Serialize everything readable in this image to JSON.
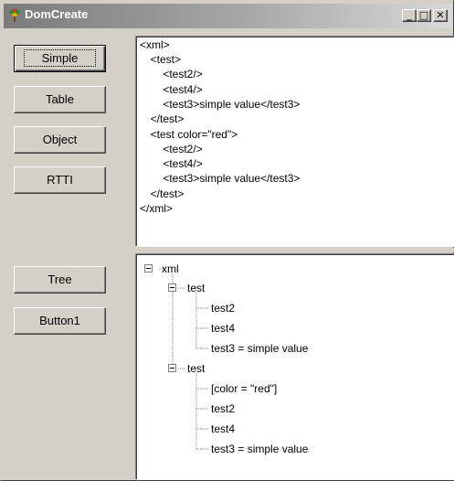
{
  "window": {
    "title": "DomCreate",
    "controls": {
      "minimize": "_",
      "maximize": "□",
      "close": "✕"
    }
  },
  "buttons": {
    "simple": "Simple",
    "table": "Table",
    "object": "Object",
    "rtti": "RTTI",
    "tree": "Tree",
    "button1": "Button1"
  },
  "memo": {
    "lines": [
      "<xml>",
      "  <test>",
      "    <test2/>",
      "    <test4/>",
      "    <test3>simple value</test3>",
      "  </test>",
      "  <test color=\"red\">",
      "    <test2/>",
      "    <test4/>",
      "    <test3>simple value</test3>",
      "  </test>",
      "</xml>"
    ]
  },
  "tree": {
    "root": "xml",
    "nodes": [
      {
        "label": "test",
        "children": [
          "test2",
          "test4",
          "test3 = simple value"
        ]
      },
      {
        "label": "test",
        "children": [
          "[color = \"red\"]",
          "test2",
          "test4",
          "test3 = simple value"
        ]
      }
    ]
  },
  "colors": {
    "face": "#d4d0c8",
    "title_start": "#7b7b7b",
    "title_end": "#d8d8d8"
  }
}
